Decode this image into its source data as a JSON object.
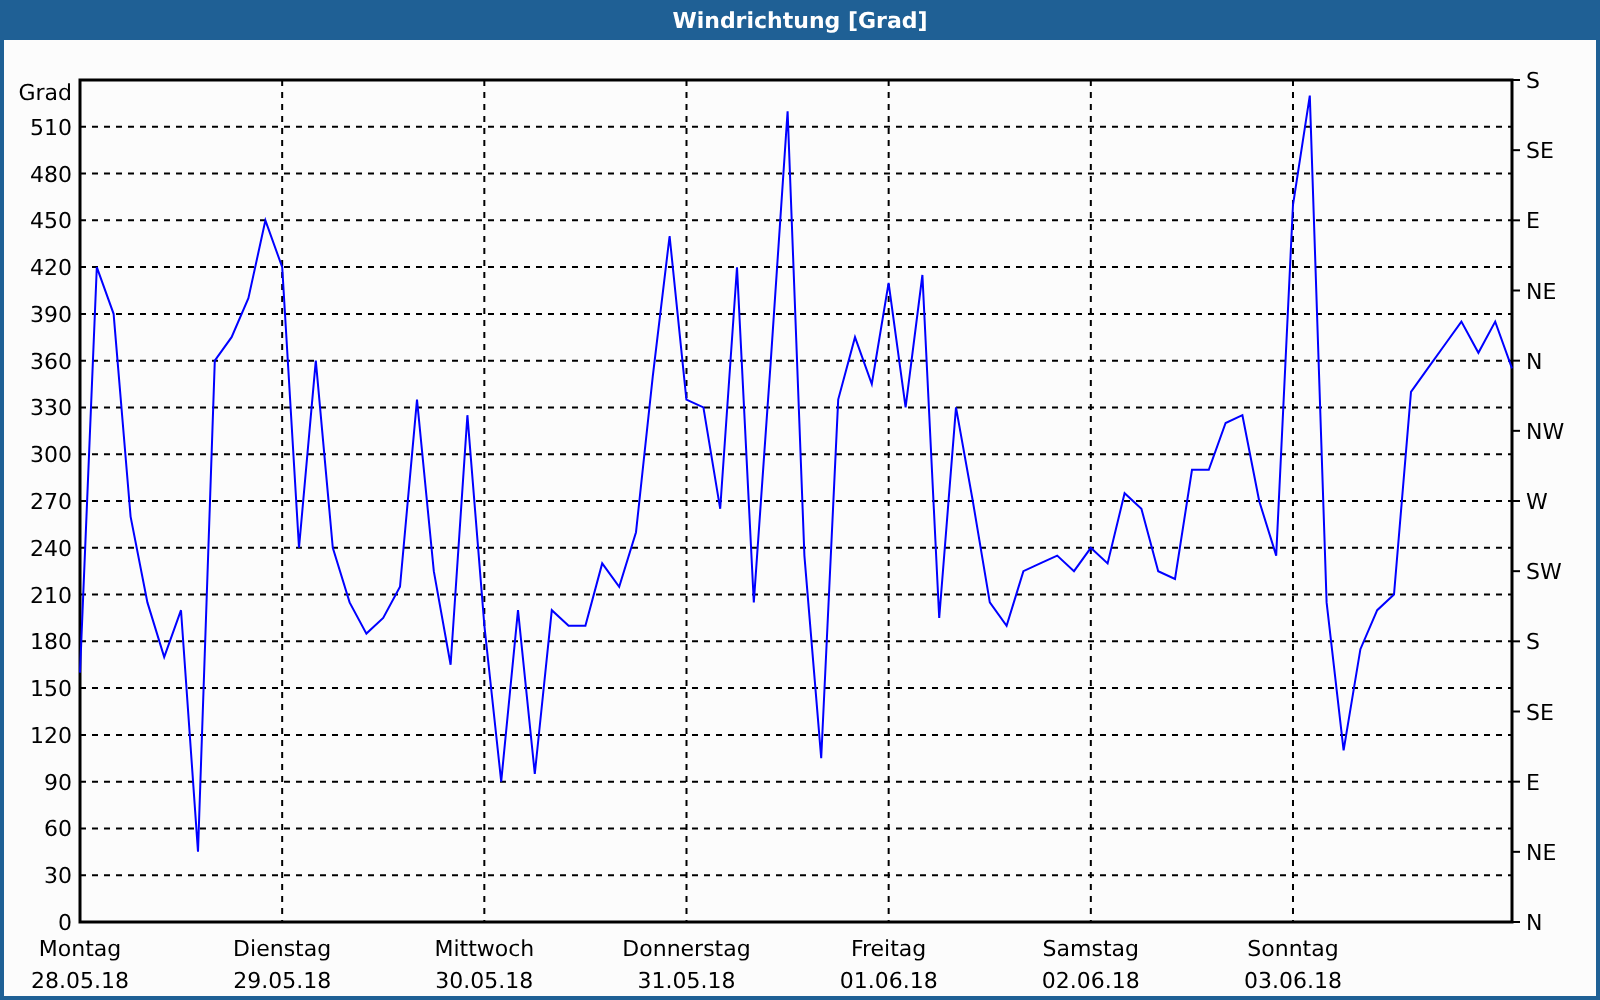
{
  "window": {
    "title": "Windrichtung [Grad]"
  },
  "chart": {
    "right_axis": [
      "S",
      "SE",
      "E",
      "NE",
      "N",
      "NW",
      "W",
      "SW",
      "S",
      "SE",
      "E",
      "NE",
      "N"
    ],
    "x_tick_days": [
      "Montag",
      "Dienstag",
      "Mittwoch",
      "Donnerstag",
      "Freitag",
      "Samstag",
      "Sonntag"
    ],
    "chart_data": {
      "type": "line",
      "grid": true,
      "ylabel": "Grad",
      "ylim": [
        0,
        540
      ],
      "yticks": [
        0,
        30,
        60,
        90,
        120,
        150,
        180,
        210,
        240,
        270,
        300,
        330,
        360,
        390,
        420,
        450,
        480,
        510
      ],
      "categories": [
        "28.05.18",
        null,
        null,
        null,
        null,
        null,
        null,
        null,
        null,
        null,
        null,
        null,
        "29.05.18",
        null,
        null,
        null,
        null,
        null,
        null,
        null,
        null,
        null,
        null,
        null,
        "30.05.18",
        null,
        null,
        null,
        null,
        null,
        null,
        null,
        null,
        null,
        null,
        null,
        "31.05.18",
        null,
        null,
        null,
        null,
        null,
        null,
        null,
        null,
        null,
        null,
        null,
        "01.06.18",
        null,
        null,
        null,
        null,
        null,
        null,
        null,
        null,
        null,
        null,
        null,
        "02.06.18",
        null,
        null,
        null,
        null,
        null,
        null,
        null,
        null,
        null,
        null,
        null,
        "03.06.18",
        null,
        null,
        null,
        null,
        null,
        null,
        null,
        null,
        null,
        null,
        null,
        null,
        null
      ],
      "series": [
        {
          "color": "#0000ff",
          "values": [
            160,
            420,
            390,
            260,
            205,
            170,
            200,
            45,
            360,
            375,
            400,
            450,
            420,
            240,
            360,
            240,
            205,
            185,
            195,
            215,
            335,
            225,
            165,
            325,
            190,
            90,
            200,
            95,
            200,
            190,
            190,
            230,
            215,
            250,
            350,
            440,
            335,
            330,
            265,
            420,
            205,
            360,
            520,
            235,
            105,
            335,
            375,
            345,
            410,
            330,
            415,
            195,
            330,
            270,
            205,
            190,
            225,
            230,
            235,
            225,
            240,
            230,
            275,
            265,
            225,
            220,
            290,
            290,
            320,
            325,
            270,
            235,
            460,
            530,
            205,
            110,
            175,
            200,
            210,
            340,
            355,
            370,
            385,
            365,
            385,
            355
          ]
        }
      ]
    }
  }
}
